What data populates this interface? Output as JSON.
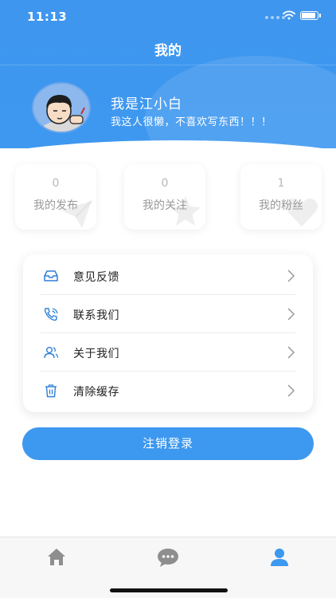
{
  "status_bar": {
    "time": "11:13"
  },
  "header": {
    "title": "我的"
  },
  "profile": {
    "name": "我是江小白",
    "bio": "我这人很懒，不喜欢写东西！！！"
  },
  "stats": [
    {
      "count": "0",
      "label": "我的发布",
      "icon": "paper-plane-icon"
    },
    {
      "count": "0",
      "label": "我的关注",
      "icon": "star-icon"
    },
    {
      "count": "1",
      "label": "我的粉丝",
      "icon": "heart-icon"
    }
  ],
  "menu": [
    {
      "label": "意见反馈",
      "icon": "inbox-icon"
    },
    {
      "label": "联系我们",
      "icon": "phone-icon"
    },
    {
      "label": "关于我们",
      "icon": "users-icon"
    },
    {
      "label": "清除缓存",
      "icon": "trash-icon"
    }
  ],
  "logout_label": "注销登录",
  "tabs": [
    {
      "icon": "home-icon",
      "active": false
    },
    {
      "icon": "chat-icon",
      "active": false
    },
    {
      "icon": "user-icon",
      "active": true
    }
  ],
  "colors": {
    "primary": "#3d98ef",
    "tab_inactive": "#8e8e8e"
  }
}
